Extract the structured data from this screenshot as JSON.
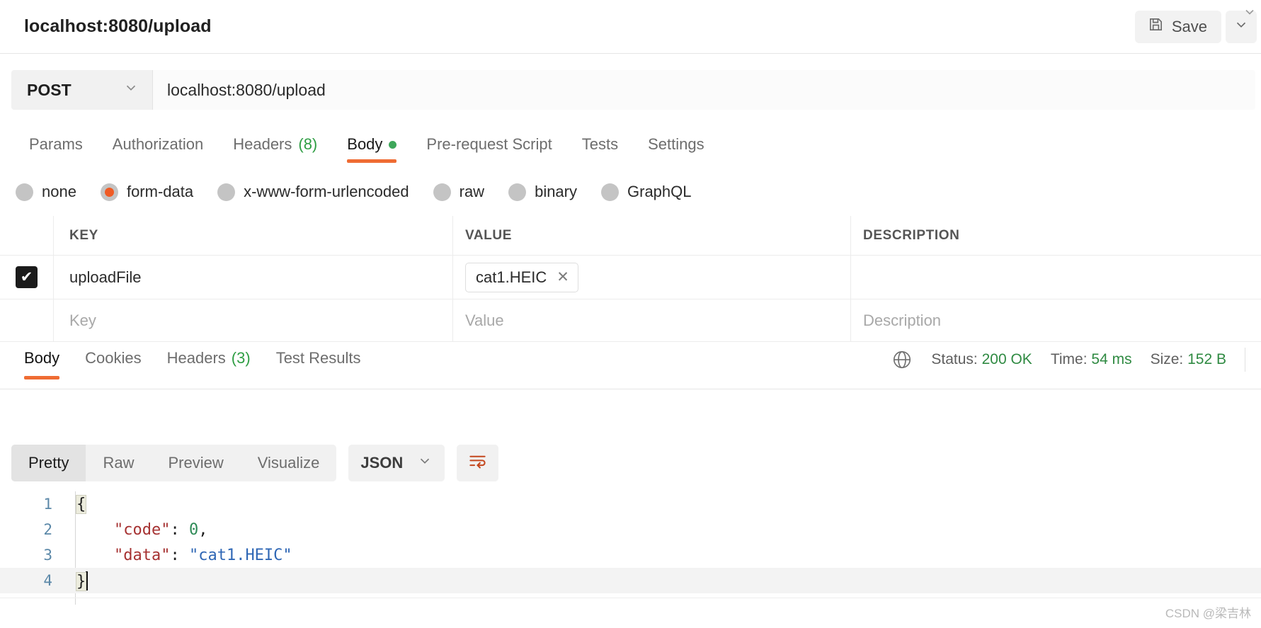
{
  "header": {
    "request_title": "localhost:8080/upload",
    "save_label": "Save",
    "save_icon": "floppy-disk-icon",
    "save_caret_icon": "chevron-down-icon",
    "scroll_caret_icon": "chevron-down-icon"
  },
  "url_row": {
    "method": "POST",
    "method_caret_icon": "chevron-down-icon",
    "url": "localhost:8080/upload"
  },
  "request_tabs": [
    {
      "label": "Params",
      "active": false
    },
    {
      "label": "Authorization",
      "active": false
    },
    {
      "label": "Headers",
      "count": "(8)",
      "active": false
    },
    {
      "label": "Body",
      "active": true,
      "dot": true
    },
    {
      "label": "Pre-request Script",
      "active": false
    },
    {
      "label": "Tests",
      "active": false
    },
    {
      "label": "Settings",
      "active": false
    }
  ],
  "body_types": [
    {
      "label": "none",
      "selected": false
    },
    {
      "label": "form-data",
      "selected": true
    },
    {
      "label": "x-www-form-urlencoded",
      "selected": false
    },
    {
      "label": "raw",
      "selected": false
    },
    {
      "label": "binary",
      "selected": false
    },
    {
      "label": "GraphQL",
      "selected": false
    }
  ],
  "params_table": {
    "columns": [
      "KEY",
      "VALUE",
      "DESCRIPTION"
    ],
    "rows": [
      {
        "checked": true,
        "check_glyph": "✔",
        "key": "uploadFile",
        "value_file": "cat1.HEIC",
        "value_remove_icon": "close-icon",
        "description": ""
      }
    ],
    "placeholders": {
      "key": "Key",
      "value": "Value",
      "description": "Description"
    }
  },
  "response": {
    "tabs": [
      {
        "label": "Body",
        "active": true
      },
      {
        "label": "Cookies",
        "active": false
      },
      {
        "label": "Headers",
        "count": "(3)",
        "active": false
      },
      {
        "label": "Test Results",
        "active": false
      }
    ],
    "meta": {
      "globe_icon": "globe-icon",
      "status_label": "Status:",
      "status_value": "200 OK",
      "time_label": "Time:",
      "time_value": "54 ms",
      "size_label": "Size:",
      "size_value": "152 B"
    },
    "view_modes": [
      {
        "label": "Pretty",
        "active": true
      },
      {
        "label": "Raw",
        "active": false
      },
      {
        "label": "Preview",
        "active": false
      },
      {
        "label": "Visualize",
        "active": false
      }
    ],
    "format": "JSON",
    "format_caret_icon": "chevron-down-icon",
    "wrap_icon": "word-wrap-icon",
    "body_lines": [
      {
        "num": "1",
        "open_brace": "{"
      },
      {
        "num": "2",
        "key": "\"code\"",
        "colon": ": ",
        "num_value": "0",
        "comma": ","
      },
      {
        "num": "3",
        "key": "\"data\"",
        "colon": ": ",
        "str_value": "\"cat1.HEIC\""
      },
      {
        "num": "4",
        "close_brace": "}"
      }
    ]
  },
  "watermark": "CSDN @梁吉林",
  "colors": {
    "accent": "#ef6c33",
    "radio_selected": "#ef5b25",
    "success": "#2f8a42",
    "json_key": "#a63232",
    "json_string": "#2f67b5",
    "json_number": "#2e8b57"
  }
}
